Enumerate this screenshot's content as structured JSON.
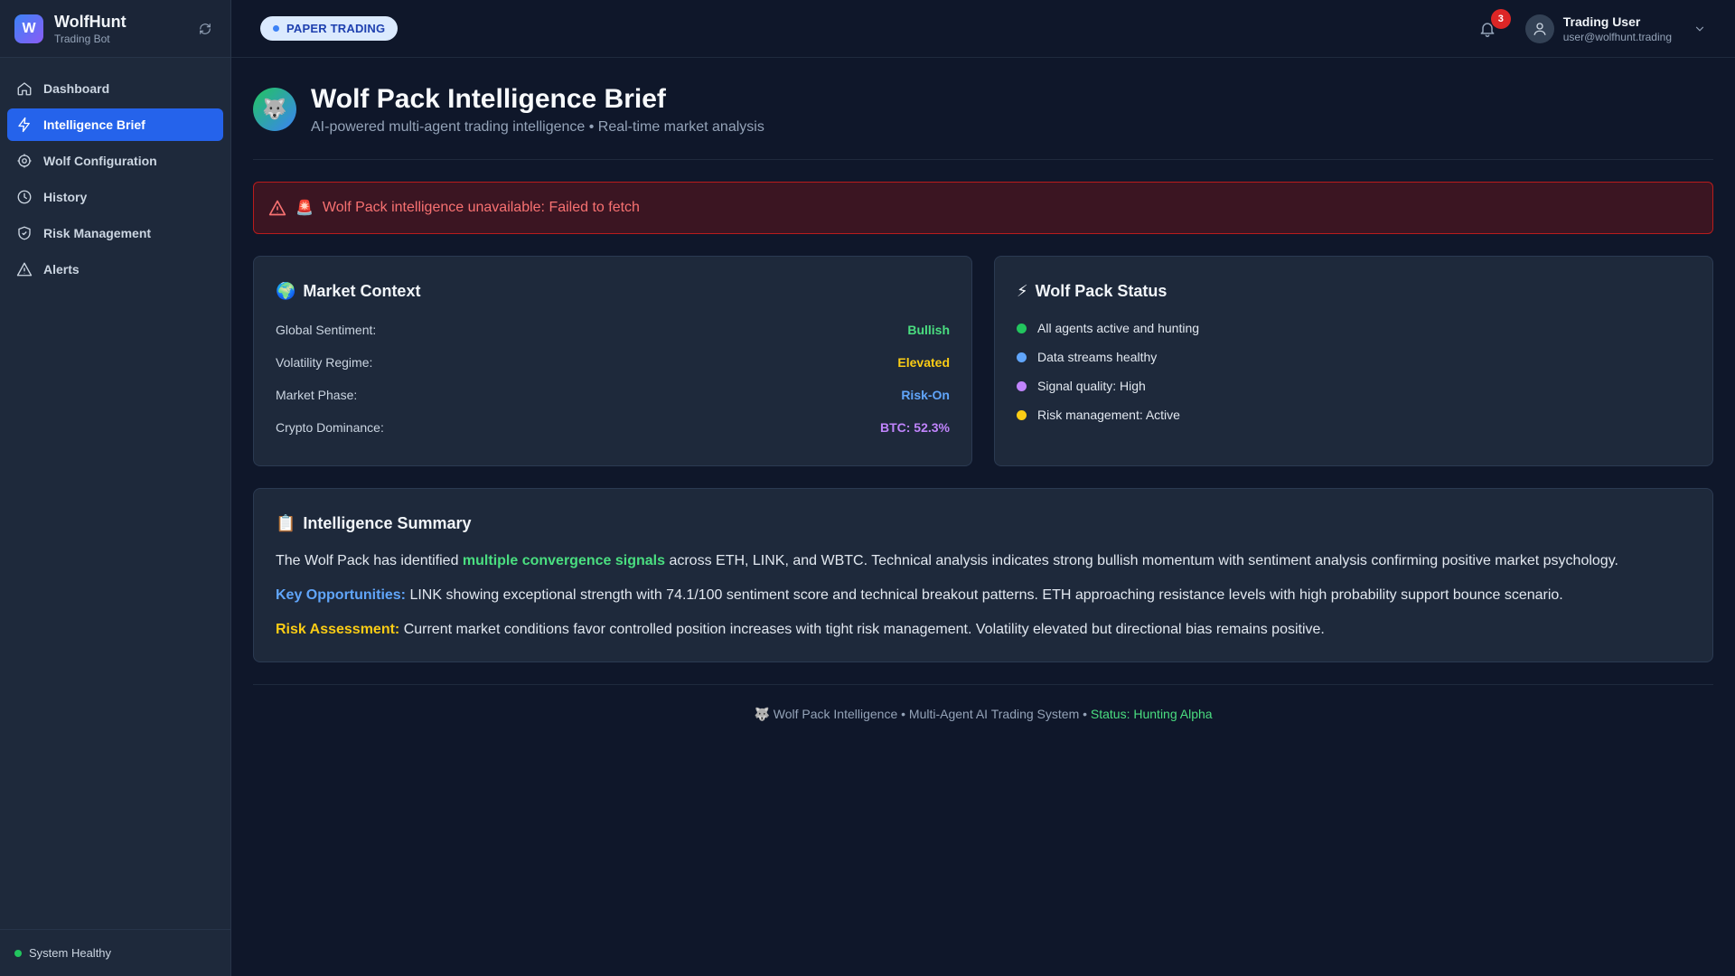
{
  "brand": {
    "logo_letter": "W",
    "name": "WolfHunt",
    "sub": "Trading Bot"
  },
  "sidebar": {
    "items": [
      {
        "label": "Dashboard",
        "icon": "home-icon"
      },
      {
        "label": "Intelligence Brief",
        "icon": "bolt-icon",
        "active": true
      },
      {
        "label": "Wolf Configuration",
        "icon": "gear-icon"
      },
      {
        "label": "History",
        "icon": "clock-icon"
      },
      {
        "label": "Risk Management",
        "icon": "shield-icon"
      },
      {
        "label": "Alerts",
        "icon": "warning-icon"
      }
    ],
    "footer_status": "System Healthy"
  },
  "topbar": {
    "mode_badge": "PAPER TRADING",
    "notification_count": "3",
    "user_name": "Trading User",
    "user_email": "user@wolfhunt.trading"
  },
  "page": {
    "avatar_emoji": "🐺",
    "title": "Wolf Pack Intelligence Brief",
    "subtitle": "AI-powered multi-agent trading intelligence • Real-time market analysis"
  },
  "alert": {
    "emoji": "🚨",
    "message": "Wolf Pack intelligence unavailable: Failed to fetch"
  },
  "market_context": {
    "emoji": "🌍",
    "title": "Market Context",
    "rows": [
      {
        "label": "Global Sentiment:",
        "value": "Bullish",
        "color": "#4ade80"
      },
      {
        "label": "Volatility Regime:",
        "value": "Elevated",
        "color": "#facc15"
      },
      {
        "label": "Market Phase:",
        "value": "Risk-On",
        "color": "#60a5fa"
      },
      {
        "label": "Crypto Dominance:",
        "value": "BTC: 52.3%",
        "color": "#c084fc"
      }
    ]
  },
  "wolf_status": {
    "emoji": "⚡",
    "title": "Wolf Pack Status",
    "rows": [
      {
        "text": "All agents active and hunting",
        "color": "#22c55e"
      },
      {
        "text": "Data streams healthy",
        "color": "#60a5fa"
      },
      {
        "text": "Signal quality: High",
        "color": "#c084fc"
      },
      {
        "text": "Risk management: Active",
        "color": "#facc15"
      }
    ]
  },
  "summary": {
    "emoji": "📋",
    "title": "Intelligence Summary",
    "p1_pre": "The Wolf Pack has identified ",
    "p1_hl": "multiple convergence signals",
    "p1_post": " across ETH, LINK, and WBTC. Technical analysis indicates strong bullish momentum with sentiment analysis confirming positive market psychology.",
    "p2_label": "Key Opportunities:",
    "p2_text": " LINK showing exceptional strength with 74.1/100 sentiment score and technical breakout patterns. ETH approaching resistance levels with high probability support bounce scenario.",
    "p3_label": "Risk Assessment:",
    "p3_text": " Current market conditions favor controlled position increases with tight risk management. Volatility elevated but directional bias remains positive."
  },
  "footer": {
    "emoji": "🐺",
    "text": " Wolf Pack Intelligence • Multi-Agent AI Trading System • ",
    "status": "Status: Hunting Alpha"
  }
}
